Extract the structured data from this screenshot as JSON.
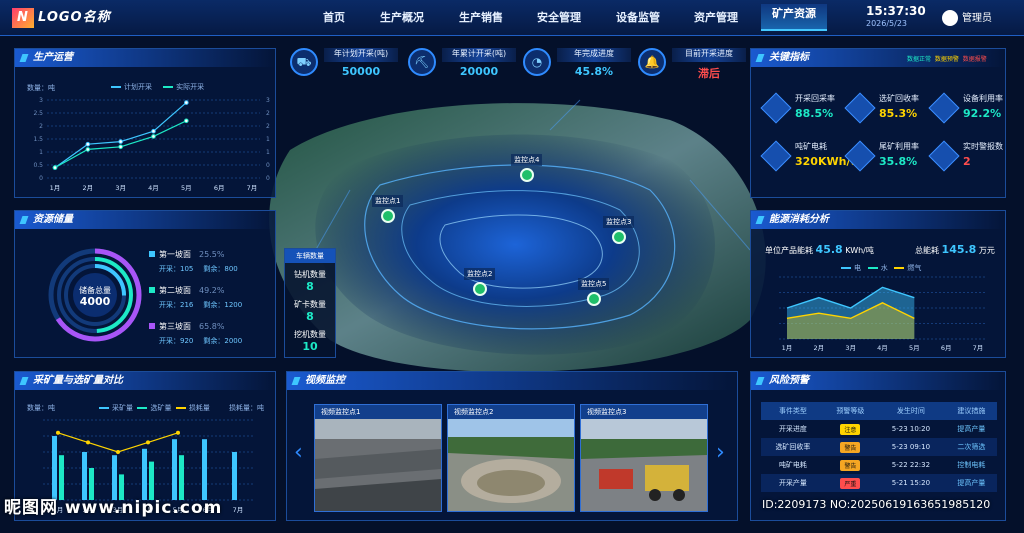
{
  "header": {
    "logo": "LOGO名称",
    "logo_mark": "N",
    "nav": [
      "首页",
      "生产概况",
      "生产销售",
      "安全管理",
      "设备监管",
      "资产管理",
      "矿产资源"
    ],
    "active_nav": "矿产资源",
    "time": "15:37:30",
    "date": "2026/5/23",
    "user": "管理员"
  },
  "production": {
    "title": "生产运营",
    "unit_left": "数量：吨",
    "legend": [
      "计划开采",
      "实际开采"
    ],
    "colors": {
      "plan": "#3ec6ff",
      "actual": "#1de9c6"
    },
    "chart_data": {
      "type": "line",
      "x": [
        "1月",
        "2月",
        "3月",
        "4月",
        "5月",
        "6月",
        "7月"
      ],
      "ylim": [
        0,
        3
      ],
      "yticks": [
        "0",
        "0.5",
        "1",
        "1.5",
        "2",
        "2.5",
        "3"
      ],
      "series": [
        {
          "name": "计划开采",
          "values": [
            0.4,
            1.3,
            1.4,
            1.8,
            2.9,
            null,
            null
          ]
        },
        {
          "name": "实际开采",
          "values": [
            0.4,
            1.1,
            1.2,
            1.6,
            2.2,
            null,
            null
          ]
        }
      ]
    }
  },
  "top_kpis": [
    {
      "icon": "truck-icon",
      "glyph": "⛟",
      "label": "年计划开采(吨)",
      "value": "50000",
      "color": "#3ec6ff"
    },
    {
      "icon": "mine-cart-icon",
      "glyph": "⛏",
      "label": "年累计开采(吨)",
      "value": "20000",
      "color": "#3ec6ff"
    },
    {
      "icon": "pie-icon",
      "glyph": "◔",
      "label": "年完成进度",
      "value": "45.8%",
      "color": "#3ec6ff"
    },
    {
      "icon": "bell-icon",
      "glyph": "🔔",
      "label": "目前开采进度",
      "value": "滞后",
      "color": "#ff4d4d"
    }
  ],
  "key_indicators": {
    "title": "关键指标",
    "status_legend": [
      {
        "label": "数据正常",
        "color": "#1de9c6"
      },
      {
        "label": "数据预警",
        "color": "#ffd400"
      },
      {
        "label": "数据报警",
        "color": "#ff4d4d"
      }
    ],
    "items": [
      {
        "icon": "chart-icon",
        "label": "开采回采率",
        "value": "88.5%",
        "color": "#1de9c6"
      },
      {
        "icon": "bar-icon",
        "label": "选矿回收率",
        "value": "85.3%",
        "color": "#ffd400"
      },
      {
        "icon": "pie-icon",
        "label": "设备利用率",
        "value": "92.2%",
        "color": "#1de9c6"
      },
      {
        "icon": "network-icon",
        "label": "吨矿电耗",
        "value": "320KWh/t",
        "color": "#ffd400"
      },
      {
        "icon": "picture-icon",
        "label": "尾矿利用率",
        "value": "35.8%",
        "color": "#1de9c6"
      },
      {
        "icon": "alarm-icon",
        "label": "实时警报数",
        "value": "2",
        "color": "#ff4d4d"
      }
    ]
  },
  "resources": {
    "title": "资源储量",
    "total_label": "储备总量",
    "total_value": "4000",
    "slopes": [
      {
        "name": "第一坡面",
        "pct": "25.5%",
        "mined_label": "开采：105",
        "remain_label": "剩余：800",
        "color": "#3ec6ff"
      },
      {
        "name": "第二坡面",
        "pct": "49.2%",
        "mined_label": "开采：216",
        "remain_label": "剩余：1200",
        "color": "#1de9c6"
      },
      {
        "name": "第三坡面",
        "pct": "65.8%",
        "mined_label": "开采：920",
        "remain_label": "剩余：2000",
        "color": "#a855f7"
      }
    ]
  },
  "vehicles": {
    "title": "车辆数量",
    "items": [
      {
        "label": "钻机数量",
        "value": "8"
      },
      {
        "label": "矿卡数量",
        "value": "8"
      },
      {
        "label": "挖机数量",
        "value": "10"
      }
    ]
  },
  "map_pins": [
    "监控点1",
    "监控点2",
    "监控点3",
    "监控点4",
    "监控点5"
  ],
  "energy": {
    "title": "能源消耗分析",
    "unit_label": "单位产品能耗",
    "unit_value": "45.8",
    "unit_unit": "KWh/吨",
    "total_label": "总能耗",
    "total_value": "145.8",
    "total_unit": "万元",
    "legend": [
      {
        "name": "电",
        "color": "#3ec6ff"
      },
      {
        "name": "水",
        "color": "#1de9c6"
      },
      {
        "name": "燃气",
        "color": "#ffd400"
      }
    ],
    "chart_data": {
      "type": "area",
      "x": [
        "1月",
        "2月",
        "3月",
        "4月",
        "5月",
        "6月",
        "7月"
      ],
      "series": [
        {
          "name": "电",
          "values": [
            3,
            4,
            3,
            5,
            4,
            null,
            null
          ]
        },
        {
          "name": "燃气",
          "values": [
            2,
            2.5,
            2,
            3.5,
            2,
            null,
            null
          ]
        }
      ]
    }
  },
  "comparison": {
    "title": "采矿量与选矿量对比",
    "unit_left": "数量：吨",
    "unit_right": "损耗量：吨",
    "legend": [
      {
        "name": "采矿量",
        "color": "#3ec6ff"
      },
      {
        "name": "选矿量",
        "color": "#1de9c6"
      },
      {
        "name": "损耗量",
        "color": "#ffd400"
      }
    ],
    "chart_data": {
      "type": "bar",
      "categories": [
        "1月",
        "2月",
        "3月",
        "4月",
        "5月",
        "6月",
        "7月"
      ],
      "ylim": [
        0,
        5
      ],
      "series": [
        {
          "name": "采矿量",
          "values": [
            4,
            3,
            2.8,
            3.2,
            3.8,
            3.8,
            3
          ]
        },
        {
          "name": "选矿量",
          "values": [
            2.8,
            2,
            1.6,
            2.4,
            2.8,
            null,
            null
          ]
        },
        {
          "name": "损耗量",
          "values": [
            4.2,
            3.6,
            3,
            3.6,
            4.2,
            null,
            null
          ]
        }
      ]
    }
  },
  "video": {
    "title": "视频监控",
    "cams": [
      "视频监控点1",
      "视频监控点2",
      "视频监控点3"
    ]
  },
  "risk": {
    "title": "风险预警",
    "headers": [
      "事件类型",
      "预警等级",
      "发生时间",
      "建议措施"
    ],
    "rows": [
      {
        "type": "开采进度",
        "level": "注意",
        "level_color": "#ffd400",
        "time": "5-23 10:20",
        "action": "提高产量"
      },
      {
        "type": "选矿回收率",
        "level": "警告",
        "level_color": "#f5a623",
        "time": "5-23 09:10",
        "action": "二次筛选"
      },
      {
        "type": "吨矿电耗",
        "level": "警告",
        "level_color": "#f5a623",
        "time": "5-22 22:32",
        "action": "控制电耗"
      },
      {
        "type": "开采产量",
        "level": "严重",
        "level_color": "#ff4d4d",
        "time": "5-21 15:20",
        "action": "提高产量"
      }
    ]
  },
  "watermark": {
    "site": "昵图网 www.nipic.com",
    "id": "ID:2209173 NO:20250619163651985120"
  }
}
